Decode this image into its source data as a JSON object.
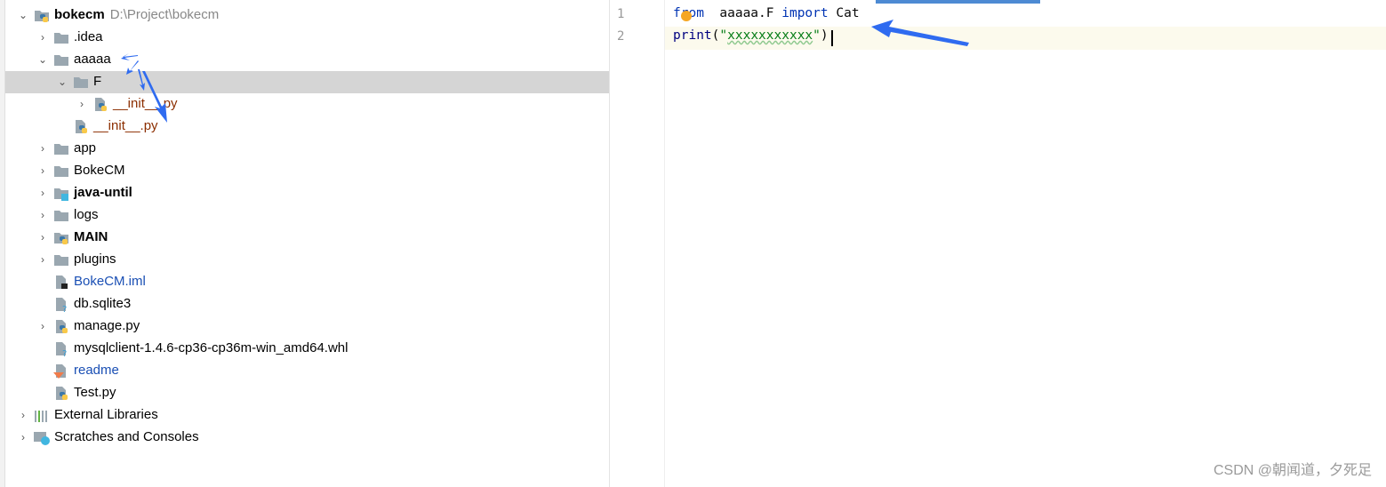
{
  "project_tree": {
    "items": [
      {
        "label": "bokecm",
        "path": "D:\\Project\\bokecm",
        "level": 0,
        "state": "expanded",
        "icon": "python-project-icon",
        "bold": true,
        "color": "#000000"
      },
      {
        "label": ".idea",
        "level": 1,
        "state": "collapsed",
        "icon": "folder-icon",
        "color": "#000000"
      },
      {
        "label": "aaaaa",
        "level": 1,
        "state": "expanded",
        "icon": "folder-icon",
        "color": "#000000"
      },
      {
        "label": "F",
        "level": 2,
        "state": "expanded",
        "icon": "folder-icon",
        "color": "#000000",
        "selected": true
      },
      {
        "label": "__init__.py",
        "level": 3,
        "state": "collapsed",
        "icon": "python-file-icon",
        "color": "#8c2e00"
      },
      {
        "label": "__init__.py",
        "level": 2,
        "state": "leaf",
        "icon": "python-file-icon",
        "color": "#8c2e00"
      },
      {
        "label": "app",
        "level": 1,
        "state": "collapsed",
        "icon": "folder-icon",
        "color": "#000000"
      },
      {
        "label": "BokeCM",
        "level": 1,
        "state": "collapsed",
        "icon": "folder-icon",
        "color": "#000000"
      },
      {
        "label": "java-until",
        "level": 1,
        "state": "collapsed",
        "icon": "module-folder-icon",
        "bold": true,
        "color": "#000000"
      },
      {
        "label": "logs",
        "level": 1,
        "state": "collapsed",
        "icon": "folder-icon",
        "color": "#000000"
      },
      {
        "label": "MAIN",
        "level": 1,
        "state": "collapsed",
        "icon": "python-module-icon",
        "bold": true,
        "color": "#000000"
      },
      {
        "label": "plugins",
        "level": 1,
        "state": "collapsed",
        "icon": "folder-icon",
        "color": "#000000"
      },
      {
        "label": "BokeCM.iml",
        "level": 1,
        "state": "leaf",
        "icon": "iml-file-icon",
        "color": "#1a4fb4"
      },
      {
        "label": "db.sqlite3",
        "level": 1,
        "state": "leaf",
        "icon": "unknown-file-icon",
        "color": "#000000"
      },
      {
        "label": "manage.py",
        "level": 1,
        "state": "collapsed",
        "icon": "python-file-icon",
        "color": "#000000"
      },
      {
        "label": "mysqlclient-1.4.6-cp36-cp36m-win_amd64.whl",
        "level": 1,
        "state": "leaf",
        "icon": "unknown-file-icon",
        "color": "#000000"
      },
      {
        "label": "readme",
        "level": 1,
        "state": "leaf",
        "icon": "readme-file-icon",
        "color": "#1a4fb4"
      },
      {
        "label": "Test.py",
        "level": 1,
        "state": "leaf",
        "icon": "python-file-icon",
        "color": "#000000"
      },
      {
        "label": "External Libraries",
        "level": 0,
        "state": "collapsed",
        "icon": "libraries-icon",
        "color": "#000000"
      },
      {
        "label": "Scratches and Consoles",
        "level": 0,
        "state": "collapsed",
        "icon": "scratches-icon",
        "color": "#000000"
      }
    ]
  },
  "editor": {
    "lines": [
      {
        "number": "1",
        "tokens": [
          [
            "kw",
            "from"
          ],
          [
            "",
            "  aaaaa.F "
          ],
          [
            "kw",
            "import"
          ],
          [
            "",
            " Cat"
          ]
        ]
      },
      {
        "number": "2",
        "tokens": [
          [
            "fn",
            "print"
          ],
          [
            "",
            "("
          ],
          [
            "str",
            "\""
          ],
          [
            "str sq",
            "xxxxxxxxxxx"
          ],
          [
            "str",
            "\""
          ],
          [
            "",
            ")"
          ]
        ]
      }
    ],
    "current_line": 2,
    "intention_icon": "lightbulb-icon"
  },
  "watermark": "CSDN @朝闻道，夕死足",
  "colors": {
    "accent": "#4d8ad3",
    "annotation_arrow": "#2f6bf0",
    "selection": "#d5d5d5"
  }
}
